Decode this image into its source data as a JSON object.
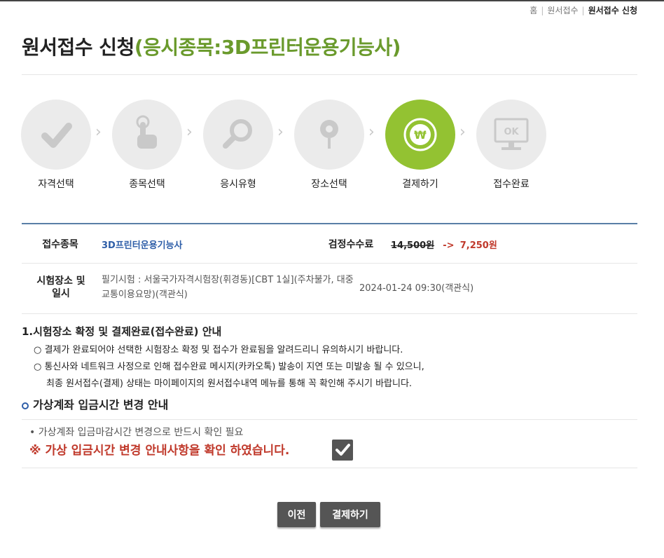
{
  "breadcrumb": {
    "home": "홈",
    "level1": "원서접수",
    "current": "원서접수 신청"
  },
  "title": {
    "main": "원서접수 신청",
    "sub": "(응시종목:3D프린터운용기능사)"
  },
  "steps": [
    {
      "label": "자격선택",
      "icon": "check-icon",
      "active": false
    },
    {
      "label": "종목선택",
      "icon": "touch-hand-icon",
      "active": false
    },
    {
      "label": "응시유형",
      "icon": "magnifier-icon",
      "active": false
    },
    {
      "label": "장소선택",
      "icon": "map-pin-icon",
      "active": false
    },
    {
      "label": "결제하기",
      "icon": "won-coin-icon",
      "active": true
    },
    {
      "label": "접수완료",
      "icon": "monitor-ok-icon",
      "active": false,
      "icon_text": "OK"
    }
  ],
  "info": {
    "item_label": "접수종목",
    "item_value": "3D프린터운용기능사",
    "fee_label": "검정수수료",
    "fee_original": "14,500원",
    "fee_arrow": "->",
    "fee_discounted": "7,250원",
    "place_label": "시험장소 및 일시",
    "place_value": "필기시험 : 서울국가자격시험장(휘경동)[CBT 1실](주차불가, 대중교통이용요망)(객관식)",
    "datetime_value": "2024-01-24 09:30(객관식)"
  },
  "notice": {
    "title": "1.시험장소 확정 및 결제완료(접수완료) 안내",
    "items": [
      "○ 결제가 완료되어야 선택한 시험장소 확정 및 접수가 완료됨을 알려드리니 유의하시기 바랍니다.",
      "○ 통신사와 네트워크 사정으로 인해 접수완료 메시지(카카오톡) 발송이 지연 또는 미발송 될 수 있으니,",
      "최종 원서접수(결제) 상태는 마이페이지의 원서접수내역 메뉴를 통해 꼭 확인해 주시기 바랍니다."
    ]
  },
  "virtual_account": {
    "title": "가상계좌 입금시간 변경 안내",
    "bullet": "• 가상계좌 입금마감시간 변경으로 반드시 확인 필요",
    "confirm_text": "※ 가상 입금시간 변경 안내사항을 확인 하였습니다.",
    "checked": true
  },
  "buttons": {
    "prev": "이전",
    "pay": "결제하기"
  },
  "colors": {
    "active_step": "#93c232",
    "title_sub": "#6a9a2c",
    "link": "#2e5ea8",
    "warning": "#c0392b",
    "button": "#555555"
  }
}
